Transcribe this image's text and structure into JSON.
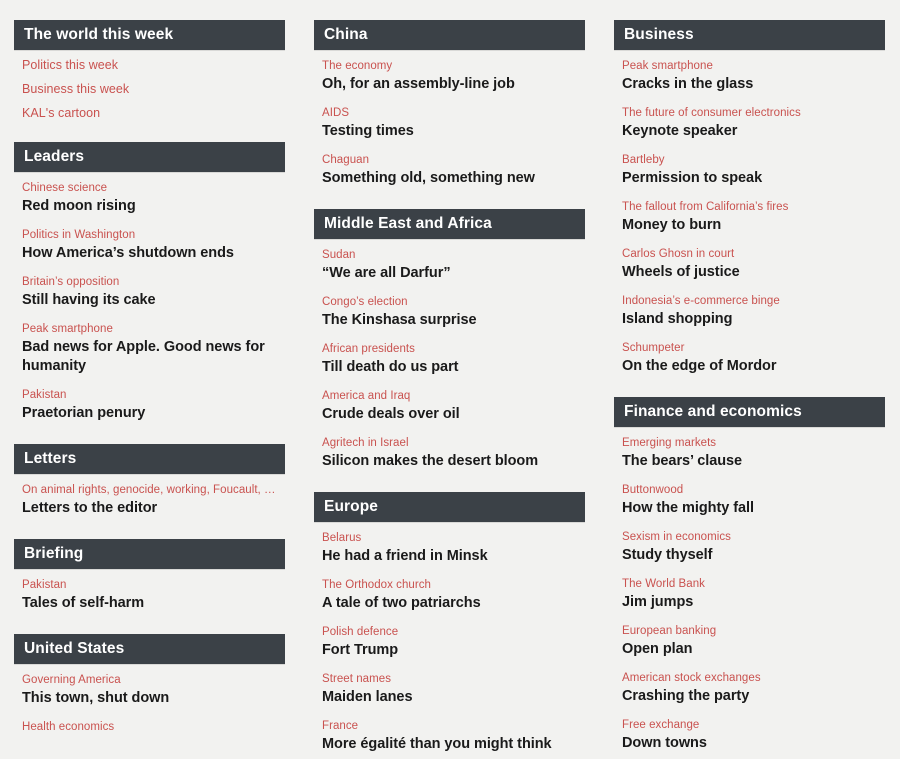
{
  "theme": {
    "background": "#f2f2f0",
    "header_bar": "#3b4147",
    "header_text": "#ffffff",
    "kicker_red": "#c9524f",
    "title_black": "#1a1a1a"
  },
  "columns": [
    {
      "name": "column-1",
      "sections": [
        {
          "id": "the-world-this-week",
          "header": "The world this week",
          "type": "links",
          "links": [
            "Politics this week",
            "Business this week",
            "KAL's cartoon"
          ]
        },
        {
          "id": "leaders",
          "header": "Leaders",
          "type": "articles",
          "articles": [
            {
              "kicker": "Chinese science",
              "title": "Red moon rising"
            },
            {
              "kicker": "Politics in Washington",
              "title": "How America’s shutdown ends"
            },
            {
              "kicker": "Britain’s opposition",
              "title": "Still having its cake"
            },
            {
              "kicker": "Peak smartphone",
              "title": "Bad news for Apple. Good news for humanity"
            },
            {
              "kicker": "Pakistan",
              "title": "Praetorian penury"
            }
          ]
        },
        {
          "id": "letters",
          "header": "Letters",
          "type": "articles",
          "articles": [
            {
              "kicker": "On animal rights, genocide, working, Foucault, …",
              "title": "Letters to the editor"
            }
          ]
        },
        {
          "id": "briefing",
          "header": "Briefing",
          "type": "articles",
          "articles": [
            {
              "kicker": "Pakistan",
              "title": "Tales of self-harm"
            }
          ]
        },
        {
          "id": "united-states",
          "header": "United States",
          "type": "articles",
          "articles": [
            {
              "kicker": "Governing America",
              "title": "This town, shut down"
            },
            {
              "kicker": "Health economics",
              "title": ""
            }
          ]
        }
      ]
    },
    {
      "name": "column-2",
      "sections": [
        {
          "id": "china",
          "header": "China",
          "type": "articles",
          "articles": [
            {
              "kicker": "The economy",
              "title": "Oh, for an assembly-line job"
            },
            {
              "kicker": "AIDS",
              "title": "Testing times"
            },
            {
              "kicker": "Chaguan",
              "title": "Something old, something new"
            }
          ]
        },
        {
          "id": "middle-east-and-africa",
          "header": "Middle East and Africa",
          "type": "articles",
          "articles": [
            {
              "kicker": "Sudan",
              "title": "“We are all Darfur”"
            },
            {
              "kicker": "Congo’s election",
              "title": "The Kinshasa surprise"
            },
            {
              "kicker": "African presidents",
              "title": "Till death do us part"
            },
            {
              "kicker": "America and Iraq",
              "title": "Crude deals over oil"
            },
            {
              "kicker": "Agritech in Israel",
              "title": "Silicon makes the desert bloom"
            }
          ]
        },
        {
          "id": "europe",
          "header": "Europe",
          "type": "articles",
          "articles": [
            {
              "kicker": "Belarus",
              "title": "He had a friend in Minsk"
            },
            {
              "kicker": "The Orthodox church",
              "title": "A tale of two patriarchs"
            },
            {
              "kicker": "Polish defence",
              "title": "Fort Trump"
            },
            {
              "kicker": "Street names",
              "title": "Maiden lanes"
            },
            {
              "kicker": "France",
              "title": "More égalité than you might think"
            }
          ]
        }
      ]
    },
    {
      "name": "column-3",
      "sections": [
        {
          "id": "business",
          "header": "Business",
          "type": "articles",
          "articles": [
            {
              "kicker": "Peak smartphone",
              "title": "Cracks in the glass"
            },
            {
              "kicker": "The future of consumer electronics",
              "title": "Keynote speaker"
            },
            {
              "kicker": "Bartleby",
              "title": "Permission to speak"
            },
            {
              "kicker": "The fallout from California’s fires",
              "title": "Money to burn"
            },
            {
              "kicker": "Carlos Ghosn in court",
              "title": "Wheels of justice"
            },
            {
              "kicker": "Indonesia’s e-commerce binge",
              "title": "Island shopping"
            },
            {
              "kicker": "Schumpeter",
              "title": "On the edge of Mordor"
            }
          ]
        },
        {
          "id": "finance-and-economics",
          "header": "Finance and economics",
          "type": "articles",
          "articles": [
            {
              "kicker": "Emerging markets",
              "title": "The bears’ clause"
            },
            {
              "kicker": "Buttonwood",
              "title": "How the mighty fall"
            },
            {
              "kicker": "Sexism in economics",
              "title": "Study thyself"
            },
            {
              "kicker": "The World Bank",
              "title": "Jim jumps"
            },
            {
              "kicker": "European banking",
              "title": "Open plan"
            },
            {
              "kicker": "American stock exchanges",
              "title": "Crashing the party"
            },
            {
              "kicker": "Free exchange",
              "title": "Down towns"
            }
          ]
        }
      ]
    }
  ]
}
